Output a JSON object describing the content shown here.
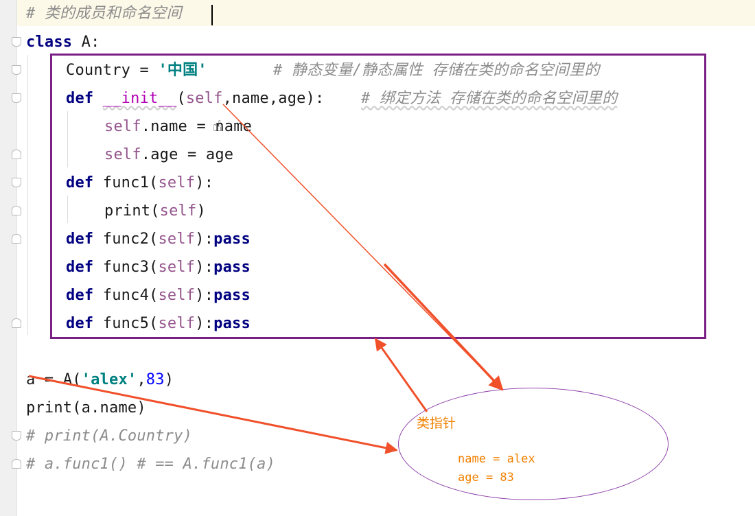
{
  "editor": {
    "line1": {
      "comment": "# 类的成员和命名空间"
    },
    "line2": {
      "kw": "class",
      "rest": " A:"
    },
    "line3": {
      "name": "Country = ",
      "str": "'中国'",
      "comment": "# 静态变量/静态属性 存储在类的命名空间里的"
    },
    "line4": {
      "kw": "def",
      "sp": " ",
      "magic": "__init__",
      "open": "(",
      "self": "self",
      "rest": ",name,age):",
      "comment": "# 绑定方法 存储在类的命名空间里的"
    },
    "line5": {
      "self": "self",
      "rest": ".name = name"
    },
    "line6": {
      "self": "self",
      "rest": ".age = age"
    },
    "line7": {
      "kw": "def",
      "rest1": " func1(",
      "self": "self",
      "rest2": "):"
    },
    "line8": {
      "rest1": "print(",
      "self": "self",
      "rest2": ")"
    },
    "line9": {
      "kw": "def",
      "rest1": " func2(",
      "self": "self",
      "rest2": "):",
      "kw2": "pass"
    },
    "line10": {
      "kw": "def",
      "rest1": " func3(",
      "self": "self",
      "rest2": "):",
      "kw2": "pass"
    },
    "line11": {
      "kw": "def",
      "rest1": " func4(",
      "self": "self",
      "rest2": "):",
      "kw2": "pass"
    },
    "line12": {
      "kw": "def",
      "rest1": " func5(",
      "self": "self",
      "rest2": "):",
      "kw2": "pass"
    },
    "line13": {
      "rest1": "a = A(",
      "str": "'alex'",
      "comma": ",",
      "num": "83",
      "rest2": ")"
    },
    "line14": {
      "text": "print(a.name)"
    },
    "line15": {
      "comment": "# print(A.Country)"
    },
    "line16": {
      "comment": "# a.func1() # == A.func1(a)"
    }
  },
  "annotations": {
    "pointer_label": "类指针",
    "obj_name": "name = alex",
    "obj_age": "age = 83",
    "frame_color": "#7a1f86",
    "arrow_color": "#f0502a",
    "label_color": "#f08000"
  }
}
